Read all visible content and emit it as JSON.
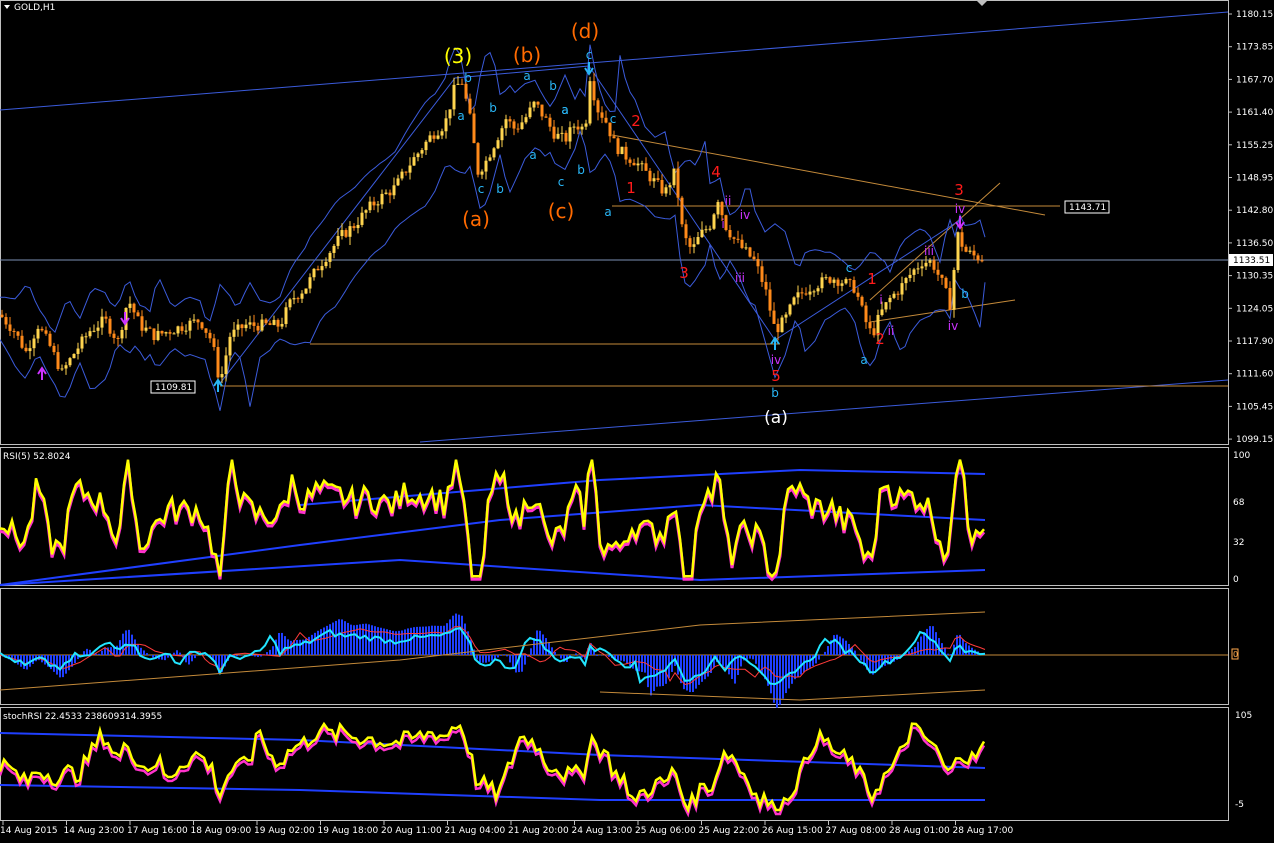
{
  "window": {
    "title": "GOLD,H1"
  },
  "price_axis": {
    "labels": [
      "1180.15",
      "1173.85",
      "1167.70",
      "1161.40",
      "1155.25",
      "1148.95",
      "1142.80",
      "1136.50",
      "1130.35",
      "1124.05",
      "1117.90",
      "1111.60",
      "1105.45",
      "1099.15"
    ]
  },
  "price_tags": {
    "current": "1133.51",
    "level_high": "1143.71",
    "level_low": "1109.81"
  },
  "rsi_panel": {
    "label": "RSI(5) 52.8024",
    "axis_labels": [
      "100",
      "68",
      "32",
      "0"
    ]
  },
  "macd_panel": {
    "axis_label": "0"
  },
  "stoch_panel": {
    "label": "stochRSI 22.4533 238609314.3955",
    "axis_labels": [
      "105",
      "-5"
    ]
  },
  "time_axis": {
    "labels": [
      "14 Aug 2015",
      "14 Aug 23:00",
      "17 Aug 16:00",
      "18 Aug 09:00",
      "19 Aug 02:00",
      "19 Aug 18:00",
      "20 Aug 11:00",
      "21 Aug 04:00",
      "21 Aug 20:00",
      "24 Aug 13:00",
      "25 Aug 06:00",
      "25 Aug 22:00",
      "26 Aug 15:00",
      "27 Aug 08:00",
      "28 Aug 01:00",
      "28 Aug 17:00"
    ]
  },
  "wave_labels": [
    {
      "text": "(3)",
      "color": "#ffff00"
    },
    {
      "text": "(b)",
      "color": "#ff6a00"
    },
    {
      "text": "(d)",
      "color": "#ff6a00"
    },
    {
      "text": "(a)",
      "color": "#ff6a00"
    },
    {
      "text": "(c)",
      "color": "#ff6a00"
    },
    {
      "text": "(a)",
      "color": "#ffffff"
    },
    {
      "text": "b",
      "color": "#29b6f6"
    },
    {
      "text": "c",
      "color": "#29b6f6"
    },
    {
      "text": "a",
      "color": "#29b6f6"
    },
    {
      "text": "b",
      "color": "#29b6f6"
    },
    {
      "text": "a",
      "color": "#29b6f6"
    },
    {
      "text": "a",
      "color": "#29b6f6"
    },
    {
      "text": "c",
      "color": "#29b6f6"
    },
    {
      "text": "b",
      "color": "#29b6f6"
    },
    {
      "text": "a",
      "color": "#29b6f6"
    },
    {
      "text": "b",
      "color": "#29b6f6"
    },
    {
      "text": "c",
      "color": "#29b6f6"
    },
    {
      "text": "b",
      "color": "#29b6f6"
    },
    {
      "text": "c",
      "color": "#29b6f6"
    },
    {
      "text": "b",
      "color": "#29b6f6"
    },
    {
      "text": "a",
      "color": "#29b6f6"
    },
    {
      "text": "c",
      "color": "#29b6f6"
    },
    {
      "text": "a",
      "color": "#29b6f6"
    },
    {
      "text": "b",
      "color": "#29b6f6"
    },
    {
      "text": "a",
      "color": "#29b6f6"
    },
    {
      "text": "2",
      "color": "#ff1a1a"
    },
    {
      "text": "1",
      "color": "#ff1a1a"
    },
    {
      "text": "4",
      "color": "#ff1a1a"
    },
    {
      "text": "3",
      "color": "#ff1a1a"
    },
    {
      "text": "5",
      "color": "#ff1a1a"
    },
    {
      "text": "1",
      "color": "#ff1a1a"
    },
    {
      "text": "2",
      "color": "#ff1a1a"
    },
    {
      "text": "3",
      "color": "#ff1a1a"
    },
    {
      "text": "ii",
      "color": "#cc33ff"
    },
    {
      "text": "i",
      "color": "#cc33ff"
    },
    {
      "text": "iv",
      "color": "#cc33ff"
    },
    {
      "text": "iii",
      "color": "#cc33ff"
    },
    {
      "text": "iv",
      "color": "#cc33ff"
    },
    {
      "text": "i",
      "color": "#cc33ff"
    },
    {
      "text": "ii",
      "color": "#cc33ff"
    },
    {
      "text": "iii",
      "color": "#cc33ff"
    },
    {
      "text": "iv",
      "color": "#cc33ff"
    },
    {
      "text": "iv",
      "color": "#cc33ff"
    }
  ],
  "chart_data": {
    "type": "candlestick",
    "symbol": "GOLD",
    "timeframe": "H1",
    "ylim": [
      1099.15,
      1180.15
    ],
    "path": [
      [
        0,
        1123
      ],
      [
        14,
        1120
      ],
      [
        26,
        1116
      ],
      [
        38,
        1121
      ],
      [
        50,
        1117
      ],
      [
        62,
        1112
      ],
      [
        75,
        1116
      ],
      [
        90,
        1120
      ],
      [
        105,
        1122
      ],
      [
        118,
        1118
      ],
      [
        128,
        1126
      ],
      [
        140,
        1121
      ],
      [
        155,
        1119
      ],
      [
        170,
        1120
      ],
      [
        185,
        1121
      ],
      [
        200,
        1122
      ],
      [
        212,
        1118
      ],
      [
        220,
        1110
      ],
      [
        230,
        1119
      ],
      [
        245,
        1121
      ],
      [
        260,
        1121
      ],
      [
        280,
        1121
      ],
      [
        292,
        1126
      ],
      [
        305,
        1128
      ],
      [
        318,
        1132
      ],
      [
        330,
        1135
      ],
      [
        342,
        1138
      ],
      [
        355,
        1140
      ],
      [
        368,
        1143
      ],
      [
        380,
        1145
      ],
      [
        395,
        1147
      ],
      [
        408,
        1151
      ],
      [
        420,
        1154
      ],
      [
        432,
        1157
      ],
      [
        445,
        1159
      ],
      [
        455,
        1166
      ],
      [
        462,
        1167
      ],
      [
        470,
        1160
      ],
      [
        478,
        1150
      ],
      [
        486,
        1152
      ],
      [
        496,
        1156
      ],
      [
        506,
        1160
      ],
      [
        515,
        1158
      ],
      [
        525,
        1160
      ],
      [
        535,
        1163
      ],
      [
        545,
        1160
      ],
      [
        555,
        1157
      ],
      [
        565,
        1156
      ],
      [
        575,
        1159
      ],
      [
        585,
        1158
      ],
      [
        590,
        1168
      ],
      [
        597,
        1162
      ],
      [
        605,
        1160
      ],
      [
        615,
        1155
      ],
      [
        625,
        1153
      ],
      [
        635,
        1152
      ],
      [
        645,
        1150
      ],
      [
        655,
        1148
      ],
      [
        665,
        1146
      ],
      [
        675,
        1150
      ],
      [
        683,
        1138
      ],
      [
        692,
        1135
      ],
      [
        700,
        1138
      ],
      [
        710,
        1140
      ],
      [
        718,
        1145
      ],
      [
        725,
        1140
      ],
      [
        735,
        1137
      ],
      [
        745,
        1135
      ],
      [
        755,
        1133
      ],
      [
        765,
        1128
      ],
      [
        775,
        1120
      ],
      [
        785,
        1122
      ],
      [
        795,
        1126
      ],
      [
        808,
        1128
      ],
      [
        820,
        1129
      ],
      [
        832,
        1130
      ],
      [
        845,
        1129
      ],
      [
        855,
        1128
      ],
      [
        865,
        1122
      ],
      [
        872,
        1119
      ],
      [
        880,
        1123
      ],
      [
        890,
        1126
      ],
      [
        900,
        1128
      ],
      [
        912,
        1131
      ],
      [
        922,
        1133
      ],
      [
        932,
        1133
      ],
      [
        942,
        1129
      ],
      [
        950,
        1125
      ],
      [
        958,
        1138
      ],
      [
        965,
        1135
      ],
      [
        975,
        1134
      ],
      [
        985,
        1133.5
      ]
    ],
    "current_price": 1133.51,
    "horizontal_levels": [
      1143.71,
      1109.81,
      1133.51
    ],
    "indicators": [
      "RSI(5)",
      "MACD",
      "stochRSI"
    ],
    "rsi_last": 52.8024,
    "stoch_rsi_values": [
      22.4533,
      238609314.3955
    ],
    "x_labels": [
      "14 Aug 2015",
      "14 Aug 23:00",
      "17 Aug 16:00",
      "18 Aug 09:00",
      "19 Aug 02:00",
      "19 Aug 18:00",
      "20 Aug 11:00",
      "21 Aug 04:00",
      "21 Aug 20:00",
      "24 Aug 13:00",
      "25 Aug 06:00",
      "25 Aug 22:00",
      "26 Aug 15:00",
      "27 Aug 08:00",
      "28 Aug 01:00",
      "28 Aug 17:00"
    ]
  },
  "colors": {
    "background": "#000000",
    "bull_candle": "#ffd54f",
    "bear_candle": "#ff8a1a",
    "bands": "#3b5bdb",
    "channel": "#3b5bdb",
    "fib_lines": "#c48a3a",
    "rsi_line": "#ffff00",
    "rsi_shadow": "#ff33cc",
    "macd_hist": "#1f3fff"
  }
}
